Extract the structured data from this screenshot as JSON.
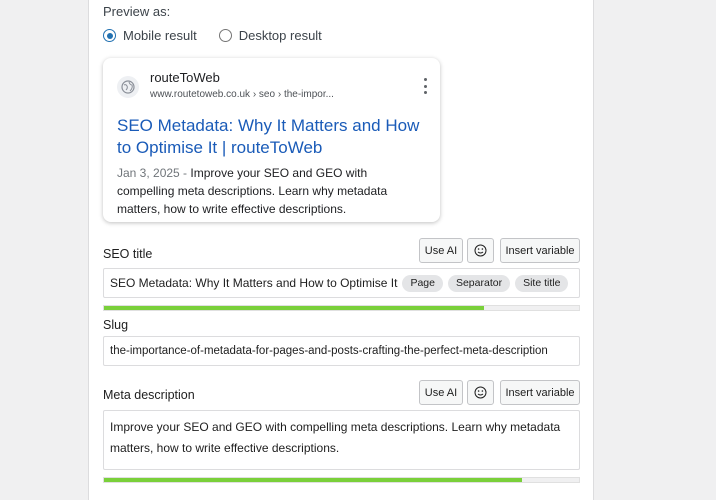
{
  "preview": {
    "label": "Preview as:",
    "options": [
      {
        "label": "Mobile result",
        "checked": true
      },
      {
        "label": "Desktop result",
        "checked": false
      }
    ]
  },
  "serp": {
    "site_name": "routeToWeb",
    "url": "www.routetoweb.co.uk › seo › the-impor...",
    "title": "SEO Metadata: Why It Matters and How to Optimise It | routeToWeb",
    "date": "Jan 3, 2025",
    "separator": " - ",
    "description": "Improve your SEO and GEO with compelling meta descriptions. Learn why metadata matters, how to write effective descriptions.",
    "icons": {
      "favicon": "globe-icon",
      "menu": "more-vertical-icon"
    }
  },
  "seo_title": {
    "label": "SEO title",
    "use_ai": "Use AI",
    "insert_variable": "Insert variable",
    "emoji_icon": "emoji-icon",
    "value": "SEO Metadata: Why It Matters and How to Optimise It",
    "variables": [
      "Page",
      "Separator",
      "Site title"
    ],
    "progress": 0.8,
    "progress_color": "#7ad03a"
  },
  "slug": {
    "label": "Slug",
    "value": "the-importance-of-metadata-for-pages-and-posts-crafting-the-perfect-meta-description"
  },
  "meta_description": {
    "label": "Meta description",
    "use_ai": "Use AI",
    "insert_variable": "Insert variable",
    "emoji_icon": "emoji-icon",
    "value": "Improve your SEO and GEO with compelling meta descriptions. Learn why metadata matters, how to write effective descriptions.",
    "progress": 0.88,
    "progress_color": "#7ad03a"
  }
}
